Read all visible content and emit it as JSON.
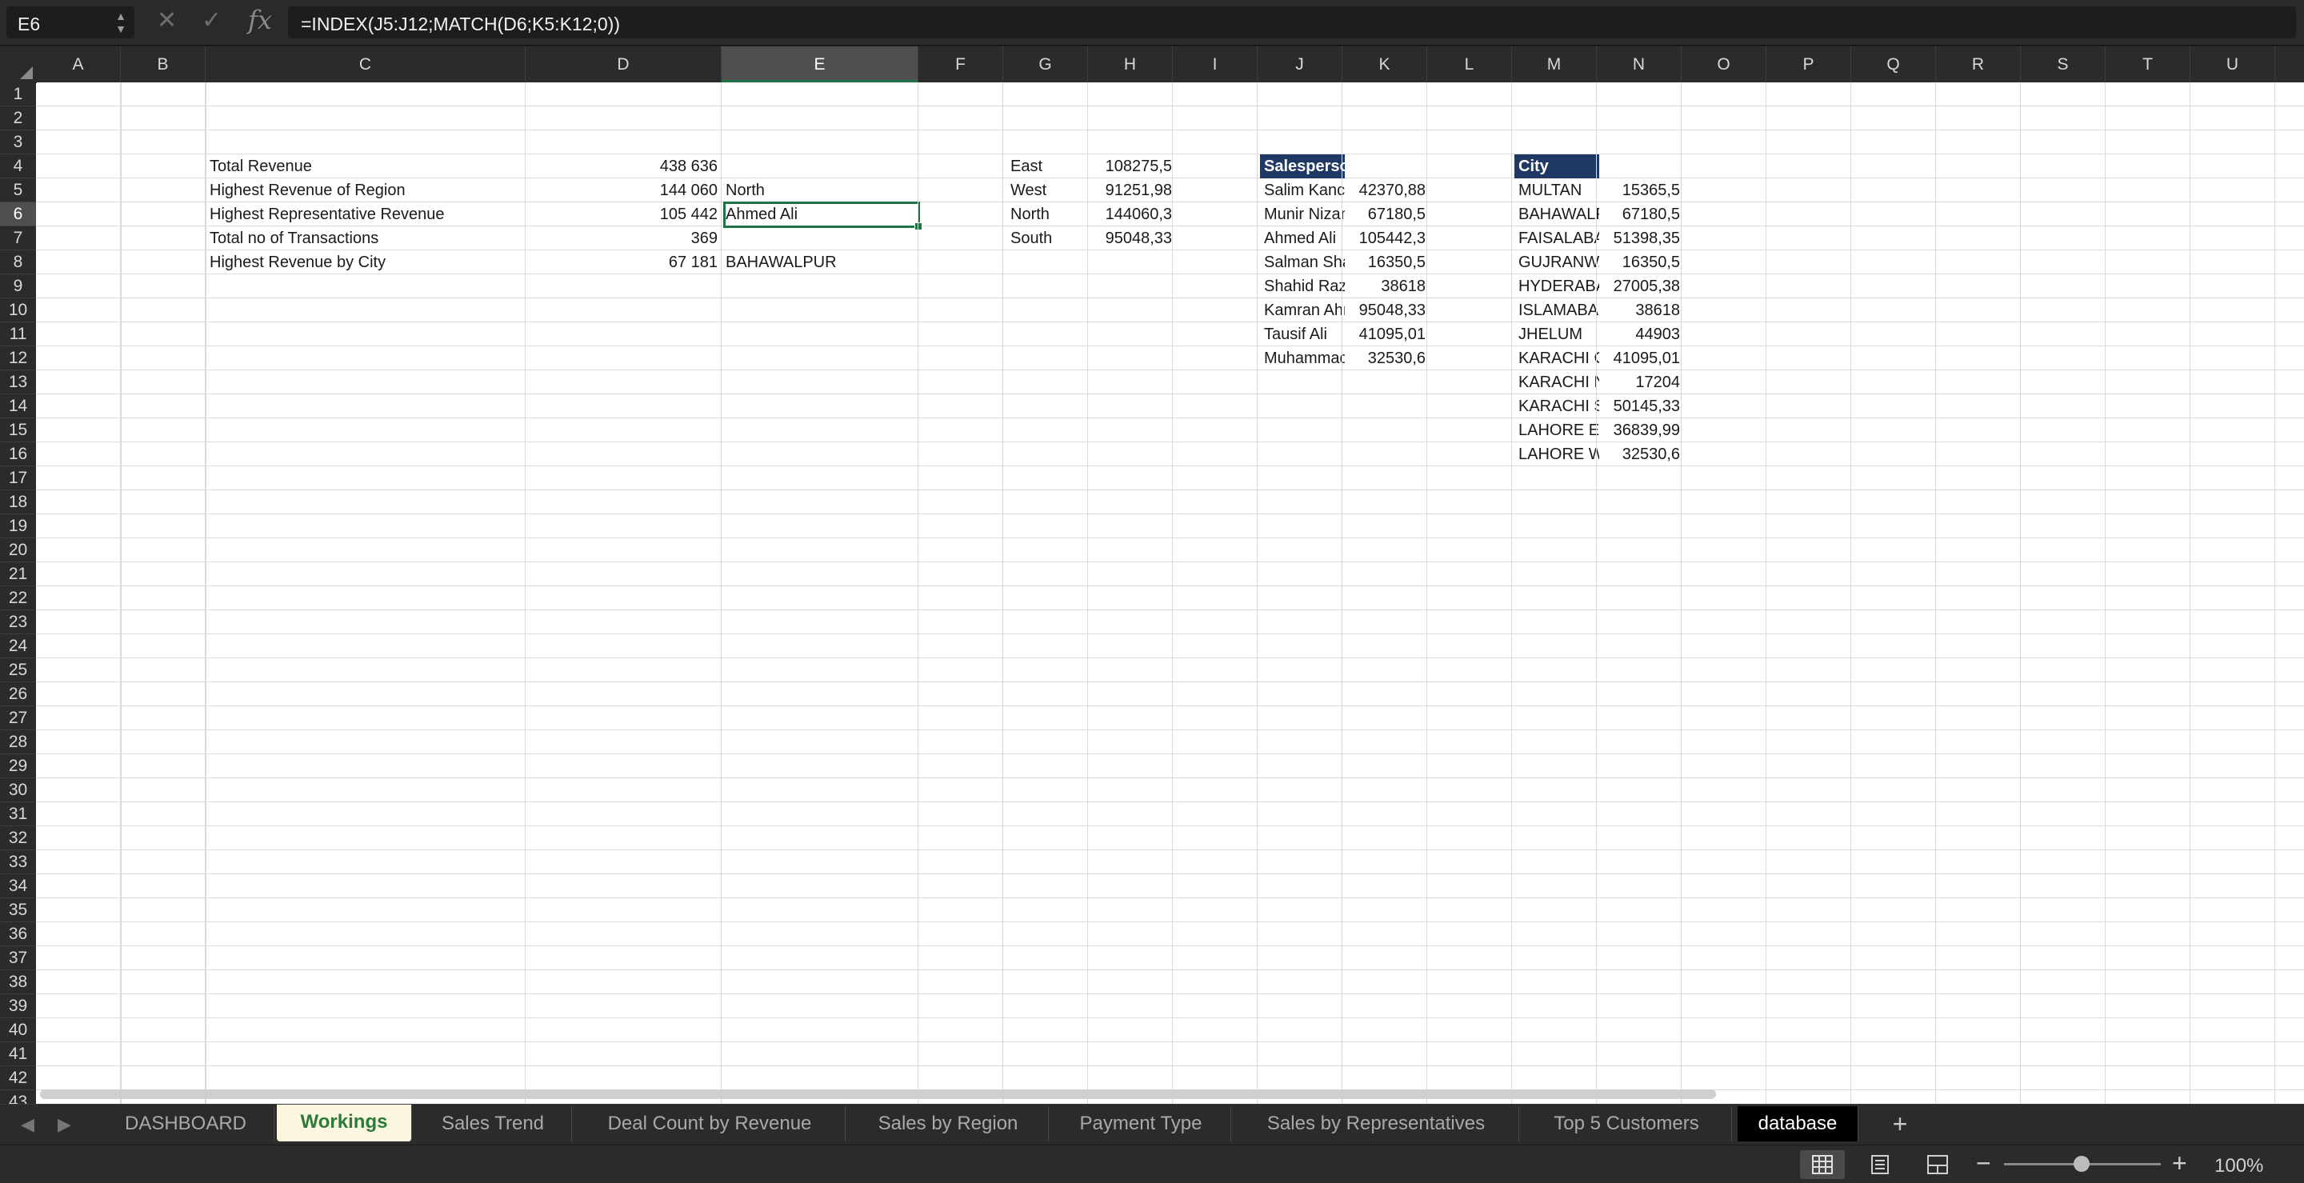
{
  "formula_bar": {
    "name_box": "E6",
    "cancel_icon": "✕",
    "enter_icon": "✓",
    "fx_label": "fx",
    "formula": "=INDEX(J5:J12;MATCH(D6;K5:K12;0))"
  },
  "columns": [
    "A",
    "B",
    "C",
    "D",
    "E",
    "F",
    "G",
    "H",
    "I",
    "J",
    "K",
    "L",
    "M",
    "N",
    "O",
    "P",
    "Q",
    "R",
    "S",
    "T",
    "U"
  ],
  "rows": [
    "1",
    "2",
    "3",
    "4",
    "5",
    "6",
    "7",
    "8",
    "9",
    "10",
    "11",
    "12",
    "13",
    "14",
    "15",
    "16",
    "17",
    "18",
    "19",
    "20",
    "21",
    "22",
    "23",
    "24",
    "25",
    "26",
    "27",
    "28",
    "29",
    "30",
    "31",
    "32",
    "33",
    "34",
    "35",
    "36",
    "37",
    "38",
    "39",
    "40",
    "41",
    "42",
    "43"
  ],
  "selected_cell": {
    "column": "E",
    "row": "6"
  },
  "summary": {
    "c4": "Total Revenue",
    "d4": "438 636",
    "c5": "Highest Revenue of Region",
    "d5": "144 060",
    "e5": "North",
    "c6": "Highest Representative Revenue",
    "d6": "105 442",
    "e6": "Ahmed Ali",
    "c7": "Total no of Transactions",
    "d7": "369",
    "c8": "Highest Revenue by City",
    "d8": "67 181",
    "e8": "BAHAWALPUR"
  },
  "regions": [
    {
      "name": "East",
      "value": "108275,5"
    },
    {
      "name": "West",
      "value": "91251,98"
    },
    {
      "name": "North",
      "value": "144060,3"
    },
    {
      "name": "South",
      "value": "95048,33"
    }
  ],
  "salesperson_table": {
    "header": "Salesperson",
    "rows": [
      {
        "name": "Salim Kanchwala",
        "value": "42370,88"
      },
      {
        "name": "Munir Nizami",
        "value": "67180,5"
      },
      {
        "name": "Ahmed Ali",
        "value": "105442,3"
      },
      {
        "name": "Salman Shah",
        "value": "16350,5"
      },
      {
        "name": "Shahid Raza",
        "value": "38618"
      },
      {
        "name": "Kamran Ahmed",
        "value": "95048,33"
      },
      {
        "name": "Tausif Ali",
        "value": "41095,01"
      },
      {
        "name": "Muhammad",
        "value": "32530,6"
      }
    ]
  },
  "city_table": {
    "header": "City",
    "rows": [
      {
        "name": "MULTAN",
        "value": "15365,5"
      },
      {
        "name": "BAHAWALPUR",
        "value": "67180,5"
      },
      {
        "name": "FAISALABAD",
        "value": "51398,35"
      },
      {
        "name": "GUJRANWALA",
        "value": "16350,5"
      },
      {
        "name": "HYDERABAD",
        "value": "27005,38"
      },
      {
        "name": "ISLAMABAD",
        "value": "38618"
      },
      {
        "name": "JHELUM",
        "value": "44903"
      },
      {
        "name": "KARACHI CENTRAL",
        "value": "41095,01"
      },
      {
        "name": "KARACHI NORTH",
        "value": "17204"
      },
      {
        "name": "KARACHI SOUTH",
        "value": "50145,33"
      },
      {
        "name": "LAHORE EAST",
        "value": "36839,99"
      },
      {
        "name": "LAHORE WEST",
        "value": "32530,6"
      }
    ]
  },
  "sheet_tabs": [
    {
      "label": "DASHBOARD"
    },
    {
      "label": "Workings",
      "active": true
    },
    {
      "label": "Sales Trend"
    },
    {
      "label": "Deal Count by Revenue"
    },
    {
      "label": "Sales by Region"
    },
    {
      "label": "Payment Type"
    },
    {
      "label": "Sales by Representatives"
    },
    {
      "label": "Top 5 Customers"
    },
    {
      "label": "database",
      "dark": true
    }
  ],
  "add_sheet": "+",
  "status": {
    "zoom_minus": "−",
    "zoom_plus": "+",
    "zoom": "100%"
  }
}
